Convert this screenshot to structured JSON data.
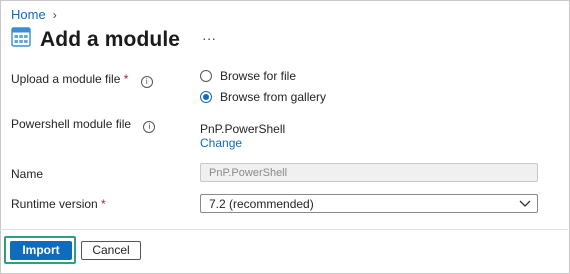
{
  "breadcrumb": {
    "home": "Home",
    "separator": "›"
  },
  "header": {
    "title": "Add a module",
    "more": "···",
    "icon": "module-grid-icon"
  },
  "form": {
    "upload": {
      "label": "Upload a module file",
      "required": "*",
      "options": [
        {
          "label": "Browse for file",
          "selected": false
        },
        {
          "label": "Browse from gallery",
          "selected": true
        }
      ]
    },
    "module_file": {
      "label": "Powershell module file",
      "value": "PnP.PowerShell",
      "change_label": "Change"
    },
    "name": {
      "label": "Name",
      "value": "PnP.PowerShell",
      "disabled": true
    },
    "runtime": {
      "label": "Runtime version",
      "required": "*",
      "selected": "7.2 (recommended)"
    }
  },
  "footer": {
    "import_label": "Import",
    "cancel_label": "Cancel"
  },
  "colors": {
    "accent": "#0f6cbd",
    "highlight": "#2e9e7e",
    "required": "#a4262c"
  }
}
